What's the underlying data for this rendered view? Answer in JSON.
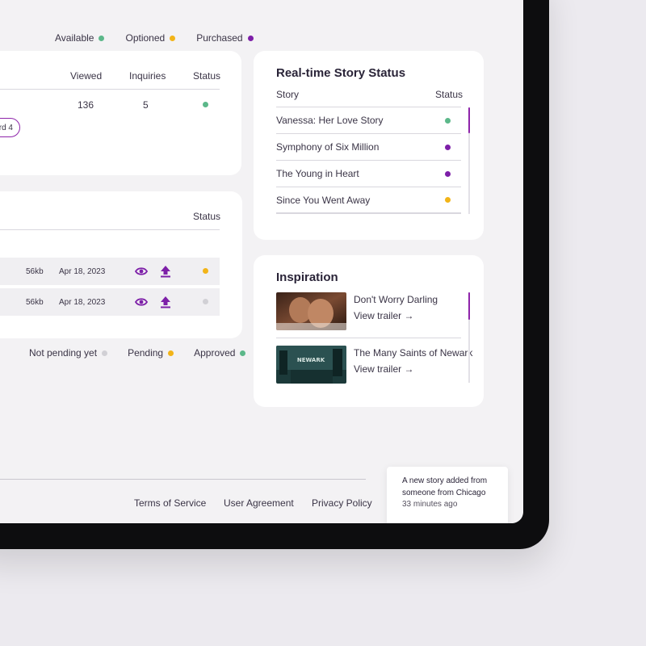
{
  "colors": {
    "available": "#5cb88a",
    "optioned": "#f2b418",
    "purchased": "#7d1fa8",
    "not_pending": "#d1d0d5",
    "pending": "#f2b418",
    "approved": "#5cb88a",
    "accent": "#8e24aa"
  },
  "top_legend": [
    {
      "label": "Available",
      "color": "#5cb88a"
    },
    {
      "label": "Optioned",
      "color": "#f2b418"
    },
    {
      "label": "Purchased",
      "color": "#7d1fa8"
    }
  ],
  "stats_table": {
    "headers": {
      "viewed": "Viewed",
      "inquiries": "Inquiries",
      "status": "Status"
    },
    "row": {
      "viewed": "136",
      "inquiries": "5",
      "status_color": "#5cb88a"
    },
    "pill_text": "rd 4"
  },
  "files_table": {
    "headers": {
      "status": "Status"
    },
    "rows": [
      {
        "size": "56kb",
        "date": "Apr 18, 2023",
        "view_icon": "eye-icon",
        "upload_icon": "upload-icon",
        "status_color": "#f2b418"
      },
      {
        "size": "56kb",
        "date": "Apr 18, 2023",
        "view_icon": "eye-icon",
        "upload_icon": "upload-icon",
        "status_color": "#d1d0d5"
      }
    ]
  },
  "bottom_legend": [
    {
      "label": "Not pending yet",
      "color": "#d1d0d5"
    },
    {
      "label": "Pending",
      "color": "#f2b418"
    },
    {
      "label": "Approved",
      "color": "#5cb88a"
    }
  ],
  "story_status": {
    "title": "Real-time Story Status",
    "col_story": "Story",
    "col_status": "Status",
    "stories": [
      {
        "name": "Vanessa: Her Love Story",
        "color": "#5cb88a"
      },
      {
        "name": "Symphony of Six Million",
        "color": "#7d1fa8"
      },
      {
        "name": "The Young in Heart",
        "color": "#7d1fa8"
      },
      {
        "name": "Since You Went Away",
        "color": "#f2b418"
      }
    ]
  },
  "inspiration": {
    "title": "Inspiration",
    "items": [
      {
        "title": "Don't Worry Darling",
        "link": "View trailer →"
      },
      {
        "title": "The Many Saints of Newark",
        "link": "View trailer →",
        "thumb_text": "NEWARK"
      }
    ]
  },
  "footer": {
    "terms": "Terms of Service",
    "agreement": "User Agreement",
    "privacy": "Privacy Policy"
  },
  "toast": {
    "message": "A new story added from someone from Chicago",
    "time": "33 minutes ago"
  }
}
